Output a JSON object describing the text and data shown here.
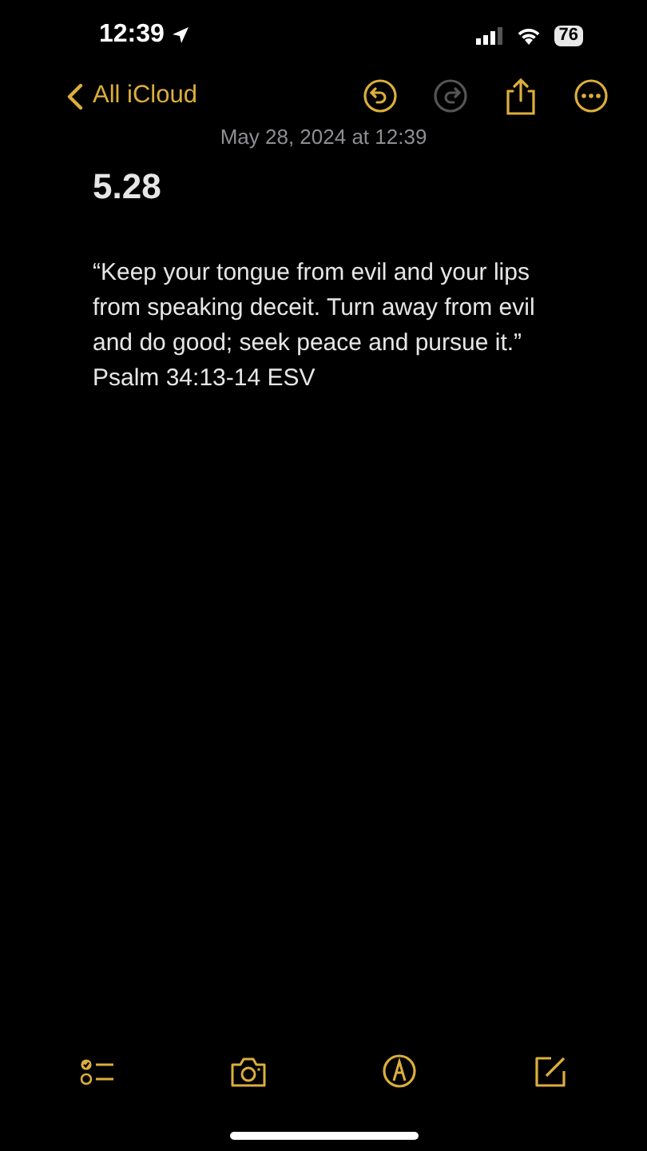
{
  "status_bar": {
    "time": "12:39",
    "battery": "76"
  },
  "nav": {
    "back_label": "All iCloud",
    "actions": [
      {
        "kind": "undo",
        "disabled": false
      },
      {
        "kind": "redo",
        "disabled": true
      },
      {
        "kind": "share",
        "disabled": false
      },
      {
        "kind": "more",
        "disabled": false
      }
    ]
  },
  "note": {
    "date": "May 28, 2024 at 12:39",
    "title": "5.28",
    "body_lines": [
      "“Keep your tongue from evil and your lips",
      "from speaking deceit. Turn away from evil",
      "and do good; seek peace and pursue it.”",
      "Psalm 34:13-14 ESV"
    ]
  },
  "toolbar": [
    {
      "kind": "checklist"
    },
    {
      "kind": "camera"
    },
    {
      "kind": "markup"
    },
    {
      "kind": "compose"
    }
  ]
}
